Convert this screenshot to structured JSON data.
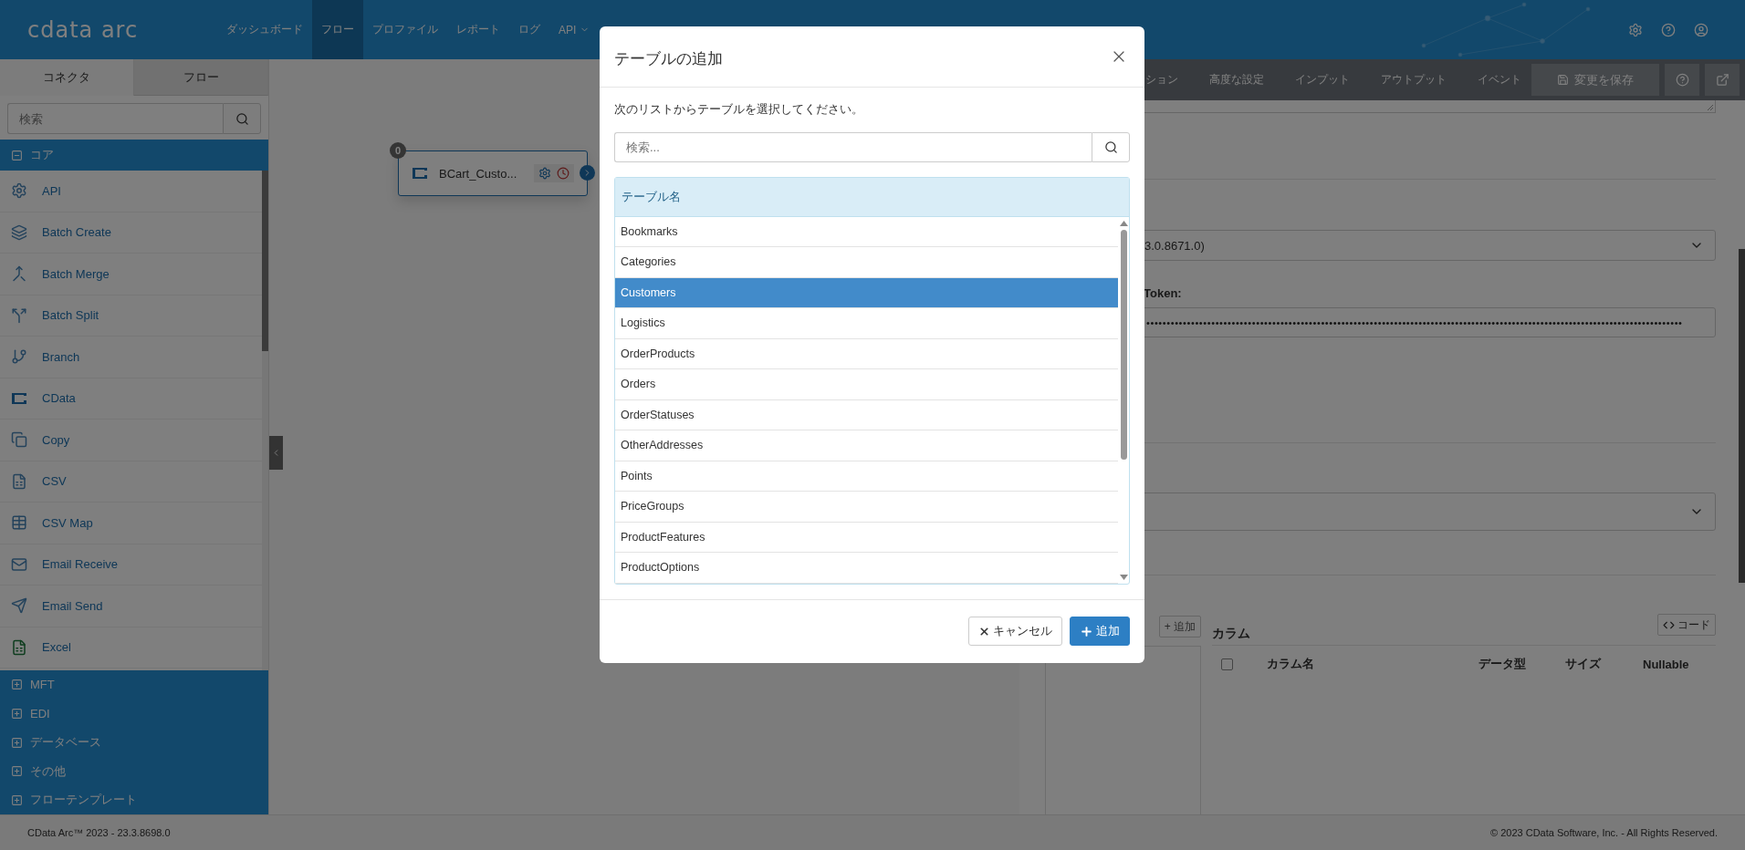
{
  "header": {
    "logo": "cdata arc",
    "nav": [
      {
        "label": "ダッシュボード",
        "selected": false
      },
      {
        "label": "フロー",
        "selected": true
      },
      {
        "label": "プロファイル",
        "selected": false
      },
      {
        "label": "レポート",
        "selected": false
      },
      {
        "label": "ログ",
        "selected": false
      },
      {
        "label": "API",
        "selected": false,
        "dropdown": true
      }
    ]
  },
  "sidebar": {
    "tabs": [
      {
        "label": "コネクタ",
        "selected": true
      },
      {
        "label": "フロー",
        "selected": false
      }
    ],
    "search": {
      "placeholder": "検索"
    },
    "groups": [
      {
        "label": "コア",
        "expanded": true,
        "items": [
          "API",
          "Batch Create",
          "Batch Merge",
          "Batch Split",
          "Branch",
          "CData",
          "Copy",
          "CSV",
          "CSV Map",
          "Email Receive",
          "Email Send",
          "Excel"
        ]
      },
      {
        "label": "MFT",
        "expanded": false
      },
      {
        "label": "EDI",
        "expanded": false
      },
      {
        "label": "データベース",
        "expanded": false
      },
      {
        "label": "その他",
        "expanded": false
      },
      {
        "label": "フローテンプレート",
        "expanded": false
      }
    ]
  },
  "canvas": {
    "node": {
      "badge": "0",
      "label": "BCart_Custo..."
    }
  },
  "panel": {
    "tabs": [
      {
        "label": "ション"
      },
      {
        "label": "高度な設定"
      },
      {
        "label": "インプット"
      },
      {
        "label": "アウトプット"
      },
      {
        "label": "イベント"
      }
    ],
    "save_button": "変更を保存",
    "version_select": {
      "value": "3.0.8671.0)"
    },
    "token_label": "Token:",
    "token_field": {
      "value": "••••••••••••••••••••••••••••••••••••••••••••••••••••••••••••••••••••••••••••••••••••••••••••••••••••••••••••••••••••••••••••••••••••"
    },
    "add_button": "+ 追加",
    "columns_title": "カラム",
    "code_button": "コード",
    "select_all": {
      "checked": false
    },
    "columns": [
      "カラム名",
      "データ型",
      "サイズ",
      "Nullable"
    ]
  },
  "dialog": {
    "title": "テーブルの追加",
    "instruction": "次のリストからテーブルを選択してください。",
    "search": {
      "placeholder": "検索..."
    },
    "column_header": "テーブル名",
    "rows": [
      {
        "name": "Bookmarks",
        "selected": false
      },
      {
        "name": "Categories",
        "selected": false
      },
      {
        "name": "Customers",
        "selected": true
      },
      {
        "name": "Logistics",
        "selected": false
      },
      {
        "name": "OrderProducts",
        "selected": false
      },
      {
        "name": "Orders",
        "selected": false
      },
      {
        "name": "OrderStatuses",
        "selected": false
      },
      {
        "name": "OtherAddresses",
        "selected": false
      },
      {
        "name": "Points",
        "selected": false
      },
      {
        "name": "PriceGroups",
        "selected": false
      },
      {
        "name": "ProductFeatures",
        "selected": false
      },
      {
        "name": "ProductOptions",
        "selected": false
      }
    ],
    "buttons": [
      {
        "kind": "cancel",
        "label": "キャンセル"
      },
      {
        "kind": "primary",
        "label": "追加"
      }
    ]
  },
  "footer": {
    "version": "CData Arc™ 2023 - 23.3.8698.0",
    "copyright": "© 2023 CData Software, Inc. - All Rights Reserved."
  }
}
